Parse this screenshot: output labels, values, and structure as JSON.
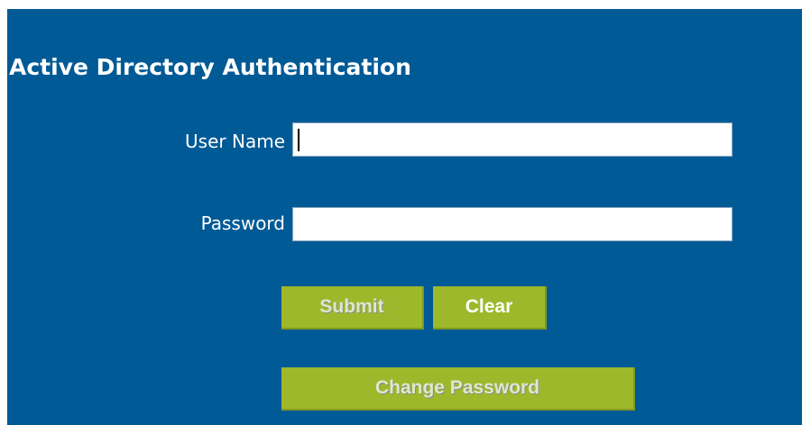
{
  "form": {
    "title": "Active Directory Authentication",
    "username_label": "User Name",
    "username_value": "",
    "password_label": "Password",
    "password_value": ""
  },
  "buttons": {
    "submit": "Submit",
    "clear": "Clear",
    "change_password": "Change Password"
  },
  "colors": {
    "panel_background": "#005a96",
    "button_background": "#9db92b"
  }
}
